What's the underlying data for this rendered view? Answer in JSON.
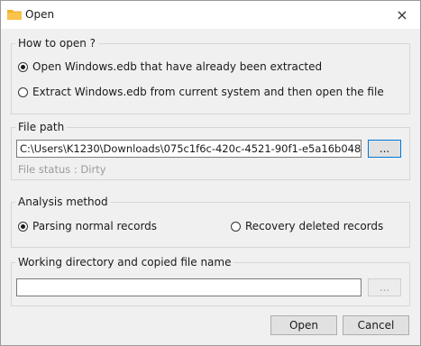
{
  "window": {
    "title": "Open",
    "folder_icon": "folder-icon",
    "close_glyph": "×"
  },
  "how_to_open": {
    "legend": "How to open ?",
    "options": [
      {
        "label": "Open Windows.edb that have already been extracted",
        "selected": true
      },
      {
        "label": "Extract Windows.edb from current system and then open the file",
        "selected": false
      }
    ]
  },
  "file_path": {
    "legend": "File path",
    "value": "C:\\Users\\K1230\\Downloads\\075c1f6c-420c-4521-90f1-e5a16b048",
    "browse_label": "...",
    "status": "File status : Dirty"
  },
  "analysis": {
    "legend": "Analysis method",
    "options": [
      {
        "label": "Parsing normal records",
        "selected": true
      },
      {
        "label": "Recovery deleted records",
        "selected": false
      }
    ]
  },
  "working_dir": {
    "legend": "Working directory and copied file name",
    "value": "",
    "browse_label": "..."
  },
  "buttons": {
    "open": "Open",
    "cancel": "Cancel"
  },
  "colors": {
    "accent": "#0078d7",
    "folder": "#f3b22b"
  }
}
